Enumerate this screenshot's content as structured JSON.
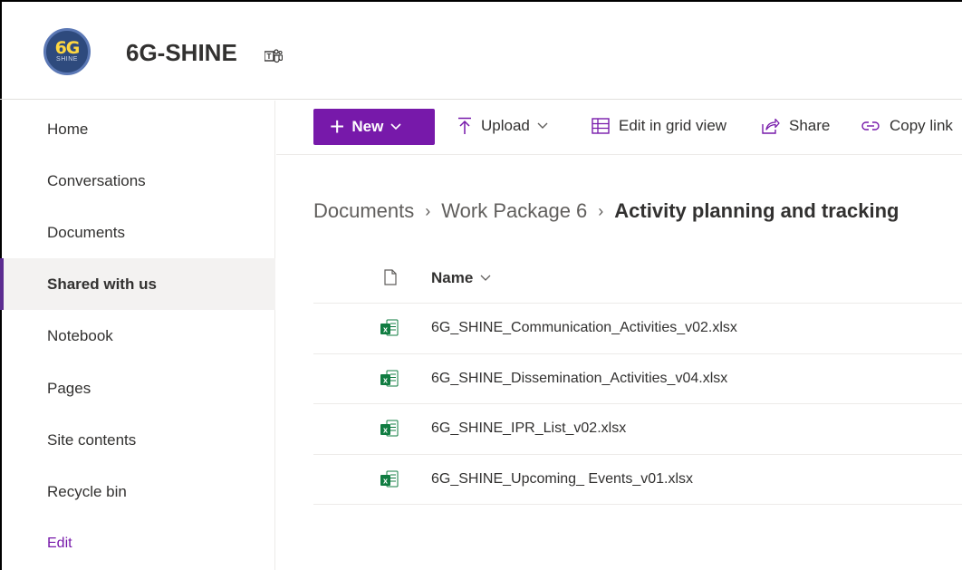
{
  "site": {
    "logo": {
      "main": "6G",
      "sub": "SHINE"
    },
    "title": "6G-SHINE"
  },
  "nav": {
    "items": [
      {
        "label": "Home",
        "selected": false
      },
      {
        "label": "Conversations",
        "selected": false
      },
      {
        "label": "Documents",
        "selected": false
      },
      {
        "label": "Shared with us",
        "selected": true
      },
      {
        "label": "Notebook",
        "selected": false
      },
      {
        "label": "Pages",
        "selected": false
      },
      {
        "label": "Site contents",
        "selected": false
      },
      {
        "label": "Recycle bin",
        "selected": false
      }
    ],
    "edit_label": "Edit"
  },
  "toolbar": {
    "new_label": "New",
    "upload_label": "Upload",
    "grid_label": "Edit in grid view",
    "share_label": "Share",
    "copy_label": "Copy link"
  },
  "breadcrumb": {
    "items": [
      "Documents",
      "Work Package 6"
    ],
    "current": "Activity planning and tracking"
  },
  "list": {
    "name_header": "Name",
    "files": [
      {
        "name": "6G_SHINE_Communication_Activities_v02.xlsx",
        "type": "excel-file-icon"
      },
      {
        "name": "6G_SHINE_Dissemination_Activities_v04.xlsx",
        "type": "excel-file-icon"
      },
      {
        "name": "6G_SHINE_IPR_List_v02.xlsx",
        "type": "excel-file-icon"
      },
      {
        "name": "6G_SHINE_Upcoming_ Events_v01.xlsx",
        "type": "excel-file-icon"
      }
    ]
  },
  "colors": {
    "accent": "#7719aa",
    "nav_selected_bar": "#5c2d91",
    "excel_green": "#107c41"
  }
}
